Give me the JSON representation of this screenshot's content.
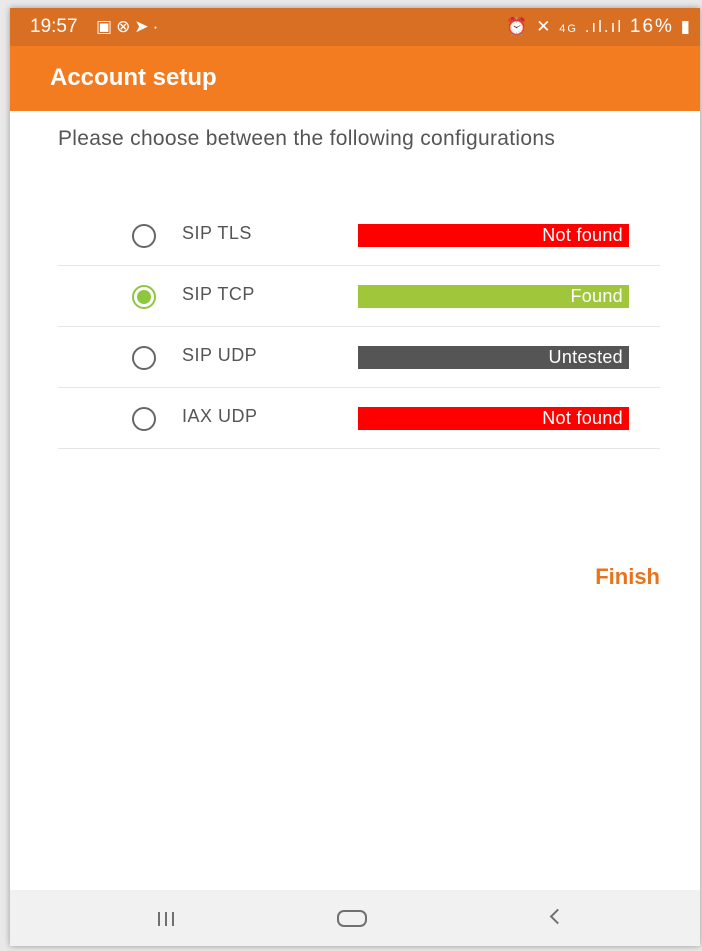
{
  "status_bar": {
    "time": "19:57",
    "left_icons": [
      "gallery-icon",
      "blocked-icon",
      "cast-icon",
      "dot-icon"
    ],
    "network": "4G",
    "battery": "16%"
  },
  "app_bar": {
    "title": "Account setup"
  },
  "prompt": "Please choose between the following configurations",
  "options": [
    {
      "label": "SIP TLS",
      "status": "Not found",
      "selected": false,
      "status_color": "#ff0000"
    },
    {
      "label": "SIP TCP",
      "status": "Found",
      "selected": true,
      "status_color": "#a0c73c"
    },
    {
      "label": "SIP UDP",
      "status": "Untested",
      "selected": false,
      "status_color": "#555555"
    },
    {
      "label": "IAX UDP",
      "status": "Not found",
      "selected": false,
      "status_color": "#ff0000"
    }
  ],
  "finish_label": "Finish",
  "colors": {
    "accent": "#f47c20",
    "status_bar": "#d96f22",
    "selected": "#8dc63f"
  },
  "nav_bar": {
    "items": [
      "recent-apps-icon",
      "home-icon",
      "back-icon"
    ]
  }
}
